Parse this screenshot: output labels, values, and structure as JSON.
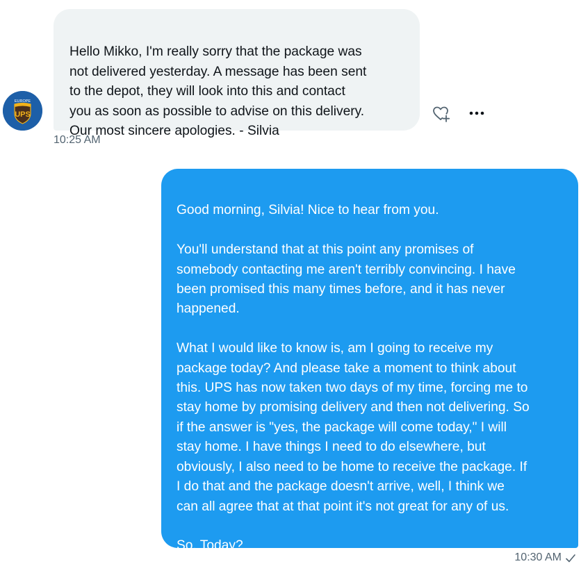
{
  "incoming": {
    "avatar_label": "EUROPE",
    "avatar_logo": "UPS",
    "message": "Hello Mikko, I'm really sorry that the package was\nnot delivered yesterday. A message has been sent\nto the depot, they will look into this and contact\nyou as soon as possible to advise on this delivery.\nOur most sincere apologies. - Silvia",
    "time": "10:25 AM",
    "actions": [
      "react-icon",
      "more-icon"
    ]
  },
  "outgoing": {
    "message": "Good morning, Silvia! Nice to hear from you.\n\nYou'll understand that at this point any promises of\nsomebody contacting me aren't terribly convincing. I have\nbeen promised this many times before, and it has never\nhappened.\n\nWhat I would like to know is, am I going to receive my\npackage today? And please take a moment to think about\nthis. UPS has now taken two days of my time, forcing me to\nstay home by promising delivery and then not delivering. So\nif the answer is \"yes, the package will come today,\" I will\nstay home. I have things I need to do elsewhere, but\nobviously, I also need to be home to receive the package. If\nI do that and the package doesn't arrive, well, I think we\ncan all agree that at that point it's not great for any of us.\n\nSo. Today?",
    "time": "10:30 AM",
    "status_icon": "checkmark-icon"
  },
  "colors": {
    "outgoing_bubble": "#1d9bf0",
    "incoming_bubble": "#eff3f4",
    "timestamp": "#536471",
    "ups_brown": "#4a2f1c",
    "ups_gold": "#f2b21b"
  }
}
